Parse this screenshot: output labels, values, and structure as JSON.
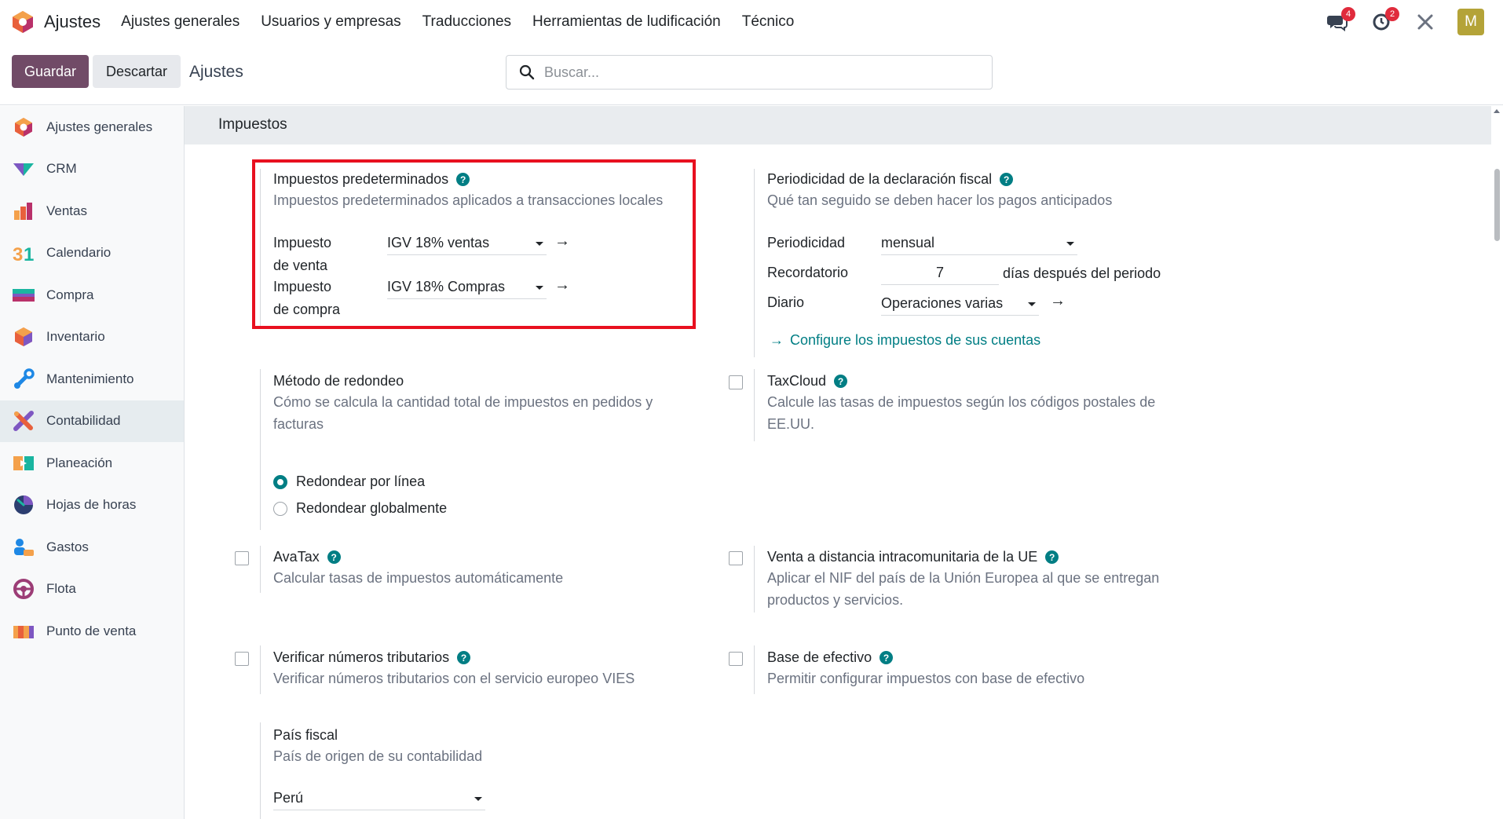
{
  "app": {
    "name": "Ajustes"
  },
  "menu": [
    "Ajustes generales",
    "Usuarios y empresas",
    "Traducciones",
    "Herramientas de ludificación",
    "Técnico"
  ],
  "systray": {
    "messages_badge": "4",
    "activity_badge": "2",
    "avatar_letter": "M"
  },
  "control_panel": {
    "save": "Guardar",
    "discard": "Descartar",
    "title": "Ajustes",
    "search_placeholder": "Buscar..."
  },
  "sidebar": {
    "items": [
      {
        "label": "Ajustes generales",
        "icon": "settings-icon"
      },
      {
        "label": "CRM",
        "icon": "crm-icon"
      },
      {
        "label": "Ventas",
        "icon": "sales-icon"
      },
      {
        "label": "Calendario",
        "icon": "calendar-icon"
      },
      {
        "label": "Compra",
        "icon": "purchase-icon"
      },
      {
        "label": "Inventario",
        "icon": "inventory-icon"
      },
      {
        "label": "Mantenimiento",
        "icon": "maintenance-icon"
      },
      {
        "label": "Contabilidad",
        "icon": "accounting-icon"
      },
      {
        "label": "Planeación",
        "icon": "planning-icon"
      },
      {
        "label": "Hojas de horas",
        "icon": "timesheets-icon"
      },
      {
        "label": "Gastos",
        "icon": "expenses-icon"
      },
      {
        "label": "Flota",
        "icon": "fleet-icon"
      },
      {
        "label": "Punto de venta",
        "icon": "pos-icon"
      }
    ],
    "active_index": 7
  },
  "section": {
    "title": "Impuestos"
  },
  "default_taxes": {
    "title": "Impuestos predeterminados",
    "desc": "Impuestos predeterminados aplicados a transacciones locales",
    "sales_label_1": "Impuesto",
    "sales_label_2": "de venta",
    "sales_value": "IGV 18% ventas",
    "purchase_label_1": "Impuesto",
    "purchase_label_2": "de compra",
    "purchase_value": "IGV 18% Compras"
  },
  "tax_return": {
    "title": "Periodicidad de la declaración fiscal",
    "desc": "Qué tan seguido se deben hacer los pagos anticipados",
    "period_label": "Periodicidad",
    "period_value": "mensual",
    "reminder_label": "Recordatorio",
    "reminder_value": "7",
    "reminder_suffix": "días después del periodo",
    "journal_label": "Diario",
    "journal_value": "Operaciones varias",
    "link": "Configure los impuestos de sus cuentas"
  },
  "rounding": {
    "title": "Método de redondeo",
    "desc": "Cómo se calcula la cantidad total de impuestos en pedidos y facturas",
    "opt1": "Redondear por línea",
    "opt2": "Redondear globalmente",
    "selected": 0
  },
  "taxcloud": {
    "title": "TaxCloud",
    "desc": "Calcule las tasas de impuestos según los códigos postales de EE.UU."
  },
  "avatax": {
    "title": "AvaTax",
    "desc": "Calcular tasas de impuestos automáticamente"
  },
  "eu_distance": {
    "title": "Venta a distancia intracomunitaria de la UE",
    "desc": "Aplicar el NIF del país de la Unión Europea al que se entregan productos y servicios."
  },
  "vat_check": {
    "title": "Verificar números tributarios",
    "desc": "Verificar números tributarios con el servicio europeo VIES"
  },
  "cash_basis": {
    "title": "Base de efectivo",
    "desc": "Permitir configurar impuestos con base de efectivo"
  },
  "fiscal_country": {
    "title": "País fiscal",
    "desc": "País de origen de su contabilidad",
    "value": "Perú"
  },
  "colors": {
    "primary": "#714b67",
    "teal": "#017e84",
    "highlight": "#e8101f"
  }
}
